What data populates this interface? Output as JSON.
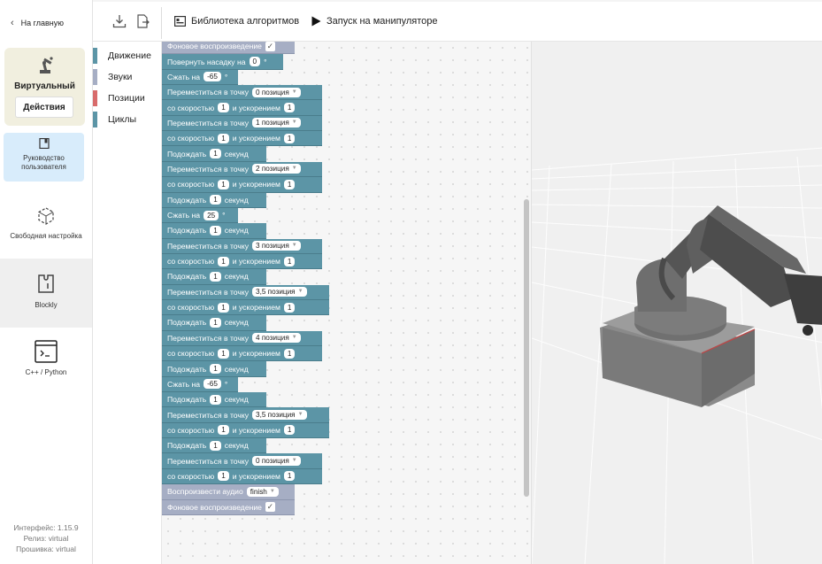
{
  "sidebar": {
    "home_label": "На главную",
    "virtual_title": "Виртуальный",
    "actions_label": "Действия",
    "guide_line1": "Руководство",
    "guide_line2": "пользователя",
    "free_label": "Свободная настройка",
    "blockly_label": "Blockly",
    "cpp_label": "C++ / Python",
    "version_interface": "Интерфейс: 1.15.9",
    "version_release": "Релиз: virtual",
    "version_firmware": "Прошивка: virtual"
  },
  "toolbar": {
    "library_label": "Библиотека алгоритмов",
    "run_label": "Запуск на манипуляторе"
  },
  "categories": [
    {
      "label": "Движение",
      "color": "#5c95a6"
    },
    {
      "label": "Звуки",
      "color": "#a6aec4"
    },
    {
      "label": "Позиции",
      "color": "#d86b6b"
    },
    {
      "label": "Циклы",
      "color": "#5c95a6"
    }
  ],
  "blocks": [
    {
      "type": "sound",
      "text": "Фоновое воспроизведение",
      "checked": true
    },
    {
      "type": "rotate",
      "text": "Повернуть насадку на",
      "value": "0",
      "unit": "°"
    },
    {
      "type": "grip",
      "text": "Сжать на",
      "value": "-65",
      "unit": "°"
    },
    {
      "type": "move",
      "text": "Переместиться в точку",
      "position": "0 позиция"
    },
    {
      "type": "speed",
      "t1": "со скоростью",
      "v1": "1",
      "t2": "и ускорением",
      "v2": "1"
    },
    {
      "type": "move",
      "text": "Переместиться в точку",
      "position": "1 позиция"
    },
    {
      "type": "speed",
      "t1": "со скоростью",
      "v1": "1",
      "t2": "и ускорением",
      "v2": "1"
    },
    {
      "type": "wait",
      "text": "Подождать",
      "value": "1",
      "unit": "секунд"
    },
    {
      "type": "move",
      "text": "Переместиться в точку",
      "position": "2 позиция"
    },
    {
      "type": "speed",
      "t1": "со скоростью",
      "v1": "1",
      "t2": "и ускорением",
      "v2": "1"
    },
    {
      "type": "wait",
      "text": "Подождать",
      "value": "1",
      "unit": "секунд"
    },
    {
      "type": "grip",
      "text": "Сжать на",
      "value": "25",
      "unit": "°"
    },
    {
      "type": "wait",
      "text": "Подождать",
      "value": "1",
      "unit": "секунд"
    },
    {
      "type": "move",
      "text": "Переместиться в точку",
      "position": "3 позиция"
    },
    {
      "type": "speed",
      "t1": "со скоростью",
      "v1": "1",
      "t2": "и ускорением",
      "v2": "1"
    },
    {
      "type": "wait",
      "text": "Подождать",
      "value": "1",
      "unit": "секунд"
    },
    {
      "type": "move",
      "text": "Переместиться в точку",
      "position": "3,5 позиция"
    },
    {
      "type": "speed",
      "t1": "со скоростью",
      "v1": "1",
      "t2": "и ускорением",
      "v2": "1"
    },
    {
      "type": "wait",
      "text": "Подождать",
      "value": "1",
      "unit": "секунд"
    },
    {
      "type": "move",
      "text": "Переместиться в точку",
      "position": "4 позиция"
    },
    {
      "type": "speed",
      "t1": "со скоростью",
      "v1": "1",
      "t2": "и ускорением",
      "v2": "1"
    },
    {
      "type": "wait",
      "text": "Подождать",
      "value": "1",
      "unit": "секунд"
    },
    {
      "type": "grip",
      "text": "Сжать на",
      "value": "-65",
      "unit": "°"
    },
    {
      "type": "wait",
      "text": "Подождать",
      "value": "1",
      "unit": "секунд"
    },
    {
      "type": "move",
      "text": "Переместиться в точку",
      "position": "3,5 позиция"
    },
    {
      "type": "speed",
      "t1": "со скоростью",
      "v1": "1",
      "t2": "и ускорением",
      "v2": "1"
    },
    {
      "type": "wait",
      "text": "Подождать",
      "value": "1",
      "unit": "секунд"
    },
    {
      "type": "move",
      "text": "Переместиться в точку",
      "position": "0 позиция"
    },
    {
      "type": "speed",
      "t1": "со скоростью",
      "v1": "1",
      "t2": "и ускорением",
      "v2": "1"
    },
    {
      "type": "play",
      "text": "Воспроизвести аудио",
      "value": "finish"
    },
    {
      "type": "sound",
      "text": "Фоновое воспроизведение",
      "checked": true
    }
  ]
}
